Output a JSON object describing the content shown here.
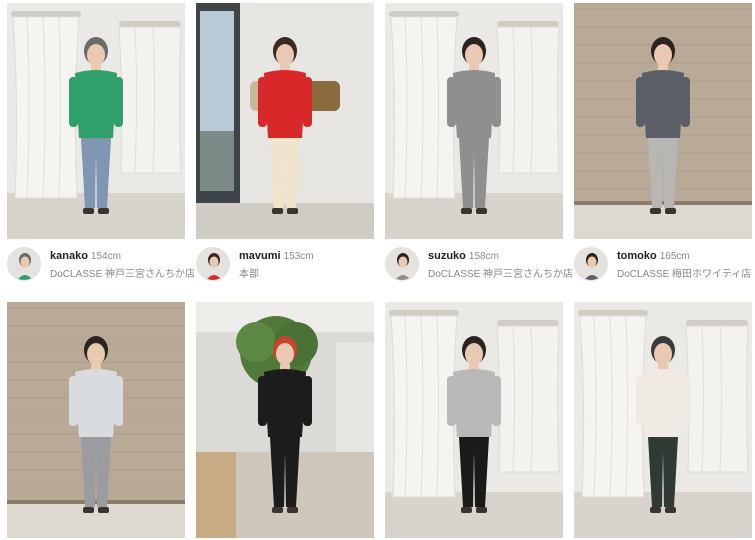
{
  "staff_posts": [
    {
      "name": "kanako",
      "height": "154cm",
      "store": "DoCLASSE 神戸三宮さんちか店",
      "top_color": "#2fa06a",
      "hair_color": "#6b6b6b",
      "bottom_color": "#7f97b2",
      "scene": "fitting-room"
    },
    {
      "name": "mavumi",
      "height": "153cm",
      "store": "本部",
      "top_color": "#d8282a",
      "hair_color": "#3a2a22",
      "bottom_color": "#efe3cc",
      "scene": "window-bags"
    },
    {
      "name": "suzuko",
      "height": "158cm",
      "store": "DoCLASSE 神戸三宮さんちか店",
      "top_color": "#8f8f8f",
      "hair_color": "#2a2420",
      "bottom_color": "#8f8f8f",
      "scene": "fitting-room"
    },
    {
      "name": "tomoko",
      "height": "165cm",
      "store": "DoCLASSE 梅田ホワイティ店",
      "top_color": "#5a5e66",
      "hair_color": "#2a2420",
      "bottom_color": "#b7b6b2",
      "scene": "wood-wall"
    },
    {
      "name": "",
      "height": "",
      "store": "",
      "top_color": "#d9dcdf",
      "hair_color": "#2a2420",
      "bottom_color": "#9a9ca0",
      "scene": "wood-wall"
    },
    {
      "name": "",
      "height": "",
      "store": "",
      "top_color": "#1c1c1c",
      "hair_color": "#c7452c",
      "bottom_color": "#1c1c1c",
      "scene": "tree-hall"
    },
    {
      "name": "",
      "height": "",
      "store": "",
      "top_color": "#b9b9b9",
      "hair_color": "#2a2420",
      "bottom_color": "#1a1a1a",
      "scene": "fitting-room"
    },
    {
      "name": "",
      "height": "",
      "store": "",
      "top_color": "#efebe4",
      "hair_color": "#3b3b3b",
      "bottom_color": "#2f3a34",
      "scene": "fitting-room"
    }
  ]
}
